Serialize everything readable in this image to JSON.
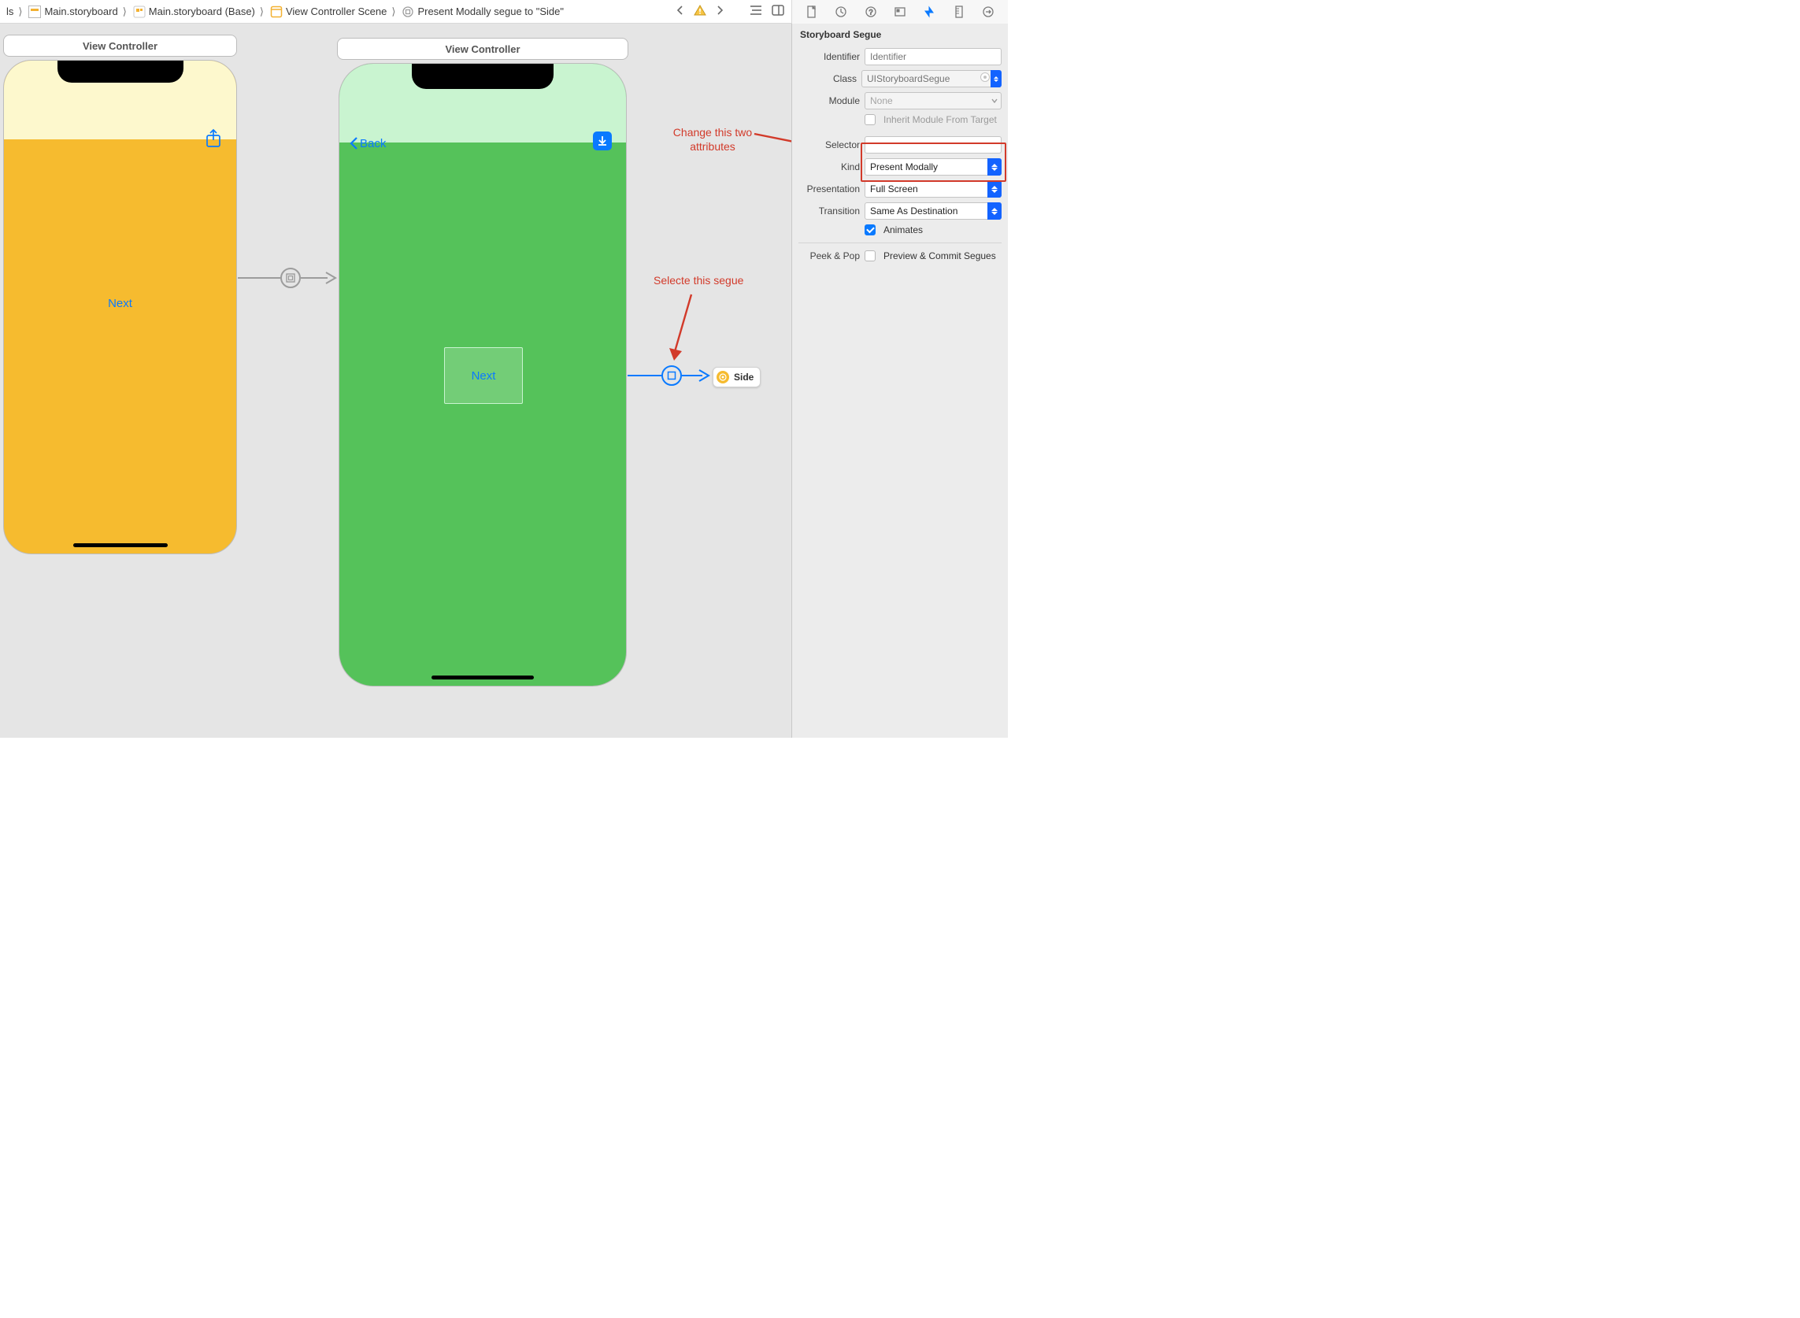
{
  "breadcrumb": {
    "c0": "ls",
    "c1": "Main.storyboard",
    "c2": "Main.storyboard (Base)",
    "c3": "View Controller Scene",
    "c4": "Present Modally segue to \"Side\""
  },
  "scene_titles": {
    "vc1": "View Controller",
    "vc2": "View Controller"
  },
  "phone1": {
    "next": "Next"
  },
  "phone2": {
    "back": "Back",
    "next": "Next"
  },
  "side_chip": "Side",
  "annotations": {
    "attrs_l1": "Change this two",
    "attrs_l2": "attributes",
    "segue": "Selecte this segue"
  },
  "inspector": {
    "section": "Storyboard Segue",
    "identifier_label": "Identifier",
    "identifier_placeholder": "Identifier",
    "class_label": "Class",
    "class_placeholder": "UIStoryboardSegue",
    "module_label": "Module",
    "module_value": "None",
    "inherit_label": "Inherit Module From Target",
    "selector_label": "Selector",
    "kind_label": "Kind",
    "kind_value": "Present Modally",
    "presentation_label": "Presentation",
    "presentation_value": "Full Screen",
    "transition_label": "Transition",
    "transition_value": "Same As Destination",
    "animates_label": "Animates",
    "peek_label": "Peek & Pop",
    "peek_value": "Preview & Commit Segues"
  }
}
